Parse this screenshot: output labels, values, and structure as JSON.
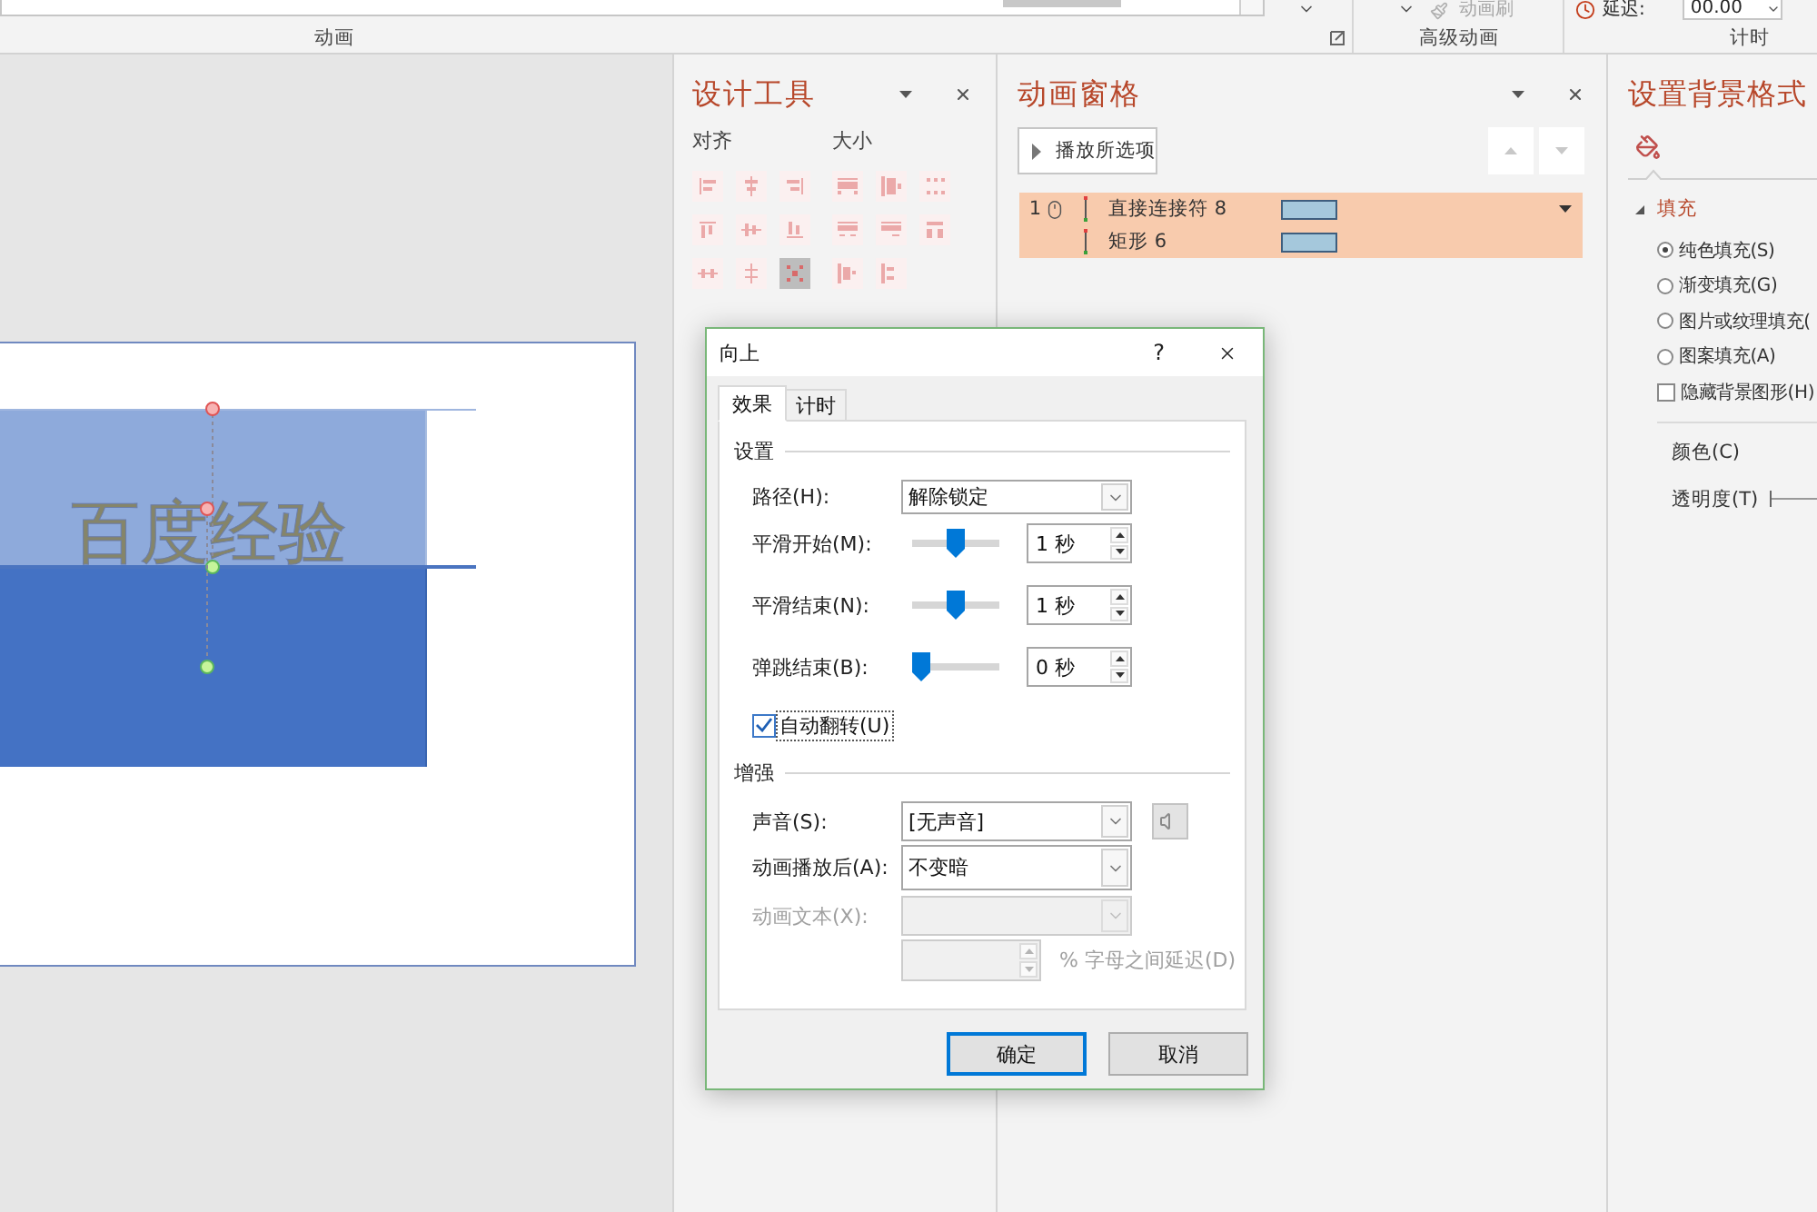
{
  "ribbon": {
    "groups": [
      {
        "label": "动画"
      },
      {
        "label": "高级动画"
      },
      {
        "label": "计时"
      }
    ],
    "animation_painter": {
      "label": "动画刷",
      "disabled": true
    },
    "delay": {
      "label": "延迟:",
      "value": "00.00"
    }
  },
  "slide": {
    "text": "百度经验"
  },
  "design_tools": {
    "title": "设计工具",
    "groups": [
      {
        "label": "对齐",
        "tools": [
          {
            "selected": false
          },
          {
            "selected": false
          },
          {
            "selected": false
          },
          {
            "selected": false
          },
          {
            "selected": false
          },
          {
            "selected": false
          },
          {
            "selected": false
          },
          {
            "selected": false
          },
          {
            "selected": true
          }
        ]
      },
      {
        "label": "大小",
        "tools": [
          {
            "selected": false
          },
          {
            "selected": false
          },
          {
            "selected": false
          },
          {
            "selected": false
          },
          {
            "selected": false
          },
          {
            "selected": false
          },
          {
            "selected": false
          },
          {
            "selected": false
          }
        ]
      }
    ]
  },
  "animation_pane": {
    "title": "动画窗格",
    "play_button": "播放所选项",
    "move_up": {
      "disabled": true
    },
    "move_down": {
      "disabled": true
    },
    "items": [
      {
        "order": "1",
        "kind": "on_click",
        "name": "直接连接符 8",
        "selected": true,
        "focused": true
      },
      {
        "kind": "with_previous",
        "name": "矩形 6",
        "selected": true,
        "focused": false
      }
    ]
  },
  "format_background": {
    "title": "设置背景格式",
    "section": {
      "label": "填充",
      "expanded": true
    },
    "fill_options": [
      {
        "label": "纯色填充(S)",
        "selected": true
      },
      {
        "label": "渐变填充(G)",
        "selected": false
      },
      {
        "label": "图片或纹理填充(",
        "selected": false
      },
      {
        "label": "图案填充(A)",
        "selected": false
      }
    ],
    "hide_graphics": {
      "label": "隐藏背景图形(H)",
      "checked": false
    },
    "color": {
      "label": "颜色(C)"
    },
    "transparency": {
      "label": "透明度(T)"
    }
  },
  "dialog": {
    "title": "向上",
    "help": "?",
    "tabs": [
      {
        "label": "效果",
        "selected": true
      },
      {
        "label": "计时",
        "selected": false
      }
    ],
    "settings": {
      "heading": "设置",
      "path": {
        "label": "路径(H):",
        "value": "解除锁定"
      },
      "timings": [
        {
          "label": "平滑开始(M):",
          "level": 0.5,
          "value": "1 秒"
        },
        {
          "label": "平滑结束(N):",
          "level": 0.5,
          "value": "1 秒"
        },
        {
          "label": "弹跳结束(B):",
          "level": 0,
          "value": "0 秒"
        }
      ],
      "auto_reverse": {
        "label": "自动翻转(U)",
        "checked": true
      }
    },
    "enhancements": {
      "heading": "增强",
      "fields": [
        {
          "label": "声音(S):",
          "value": "[无声音]",
          "disabled": false,
          "kind": "sound"
        },
        {
          "label": "动画播放后(A):",
          "value": "不变暗",
          "disabled": false,
          "kind": "plain"
        },
        {
          "label": "动画文本(X):",
          "disabled": true,
          "kind": "plain"
        }
      ],
      "letter_delay": {
        "label": "% 字母之间延迟(D)",
        "disabled": true
      }
    },
    "buttons": [
      {
        "label": "确定",
        "default": true
      },
      {
        "label": "取消",
        "default": false
      }
    ]
  }
}
